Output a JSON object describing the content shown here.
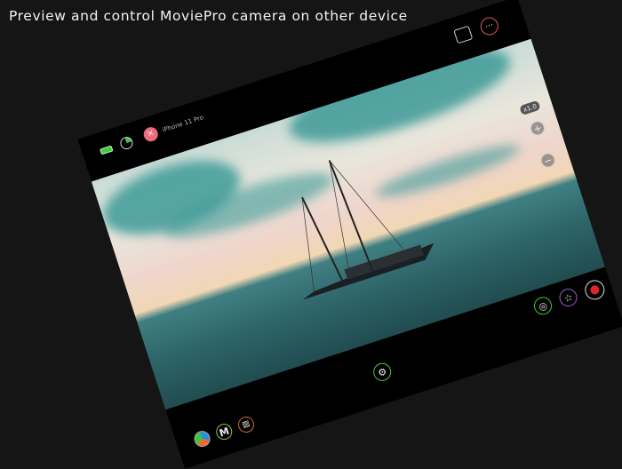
{
  "headline": "Preview and control MoviePro camera on other device",
  "device": {
    "name": "iPhone 11 Pro",
    "zoom_label": "x1.0",
    "mode_label": "M"
  },
  "colors": {
    "accent_green": "#3ec43e",
    "record_red": "#e0242c",
    "battery": "#33d43a"
  }
}
